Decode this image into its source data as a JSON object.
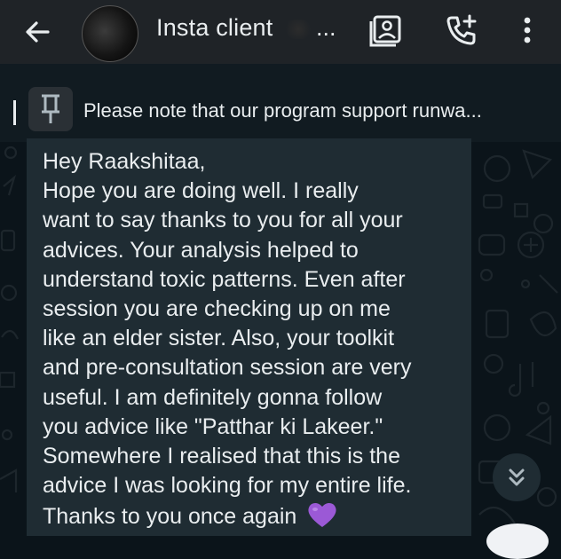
{
  "header": {
    "title": "Insta client",
    "title_suffix": "...",
    "back_icon": "arrow-left-icon",
    "contact_card_icon": "contact-card-icon",
    "call_add_icon": "add-call-icon",
    "menu_icon": "more-vertical-icon"
  },
  "pinned": {
    "icon": "pin-icon",
    "text": "Please note that our program support runwa..."
  },
  "message": {
    "lines": [
      "Hey Raakshitaa,",
      "Hope you are doing well. I really",
      "want to say thanks to you for all your",
      "advices. Your analysis helped to",
      "understand toxic patterns. Even after",
      "session you are checking up on me",
      "like an elder sister. Also, your toolkit",
      "and pre-consultation session are very",
      "useful. I am definitely gonna follow",
      "you advice like \"Patthar ki Lakeer.\"",
      "Somewhere I realised that this is the",
      "advice I was looking for my entire life.",
      "Thanks to you once again"
    ],
    "emoji": "purple-heart-icon"
  },
  "scroll_button": {
    "icon": "double-chevron-down-icon"
  },
  "colors": {
    "header_bg": "#1f2327",
    "chat_bg": "#0b141a",
    "bubble_bg": "#1f2c33",
    "text": "#e9edef",
    "heart": "#9b59d6"
  }
}
